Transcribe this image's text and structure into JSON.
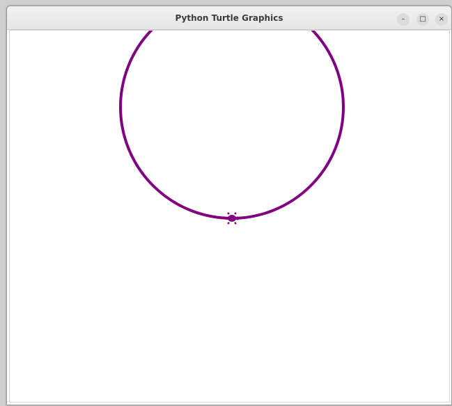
{
  "window": {
    "title": "Python Turtle Graphics",
    "controls": {
      "minimize_icon": "–",
      "maximize_icon": "□",
      "close_icon": "×"
    }
  },
  "canvas": {
    "background": "#ffffff",
    "pen_color": "#800080",
    "turtle_color": "#800080",
    "drawing": "circle",
    "turtle_shape": "turtle-icon"
  }
}
